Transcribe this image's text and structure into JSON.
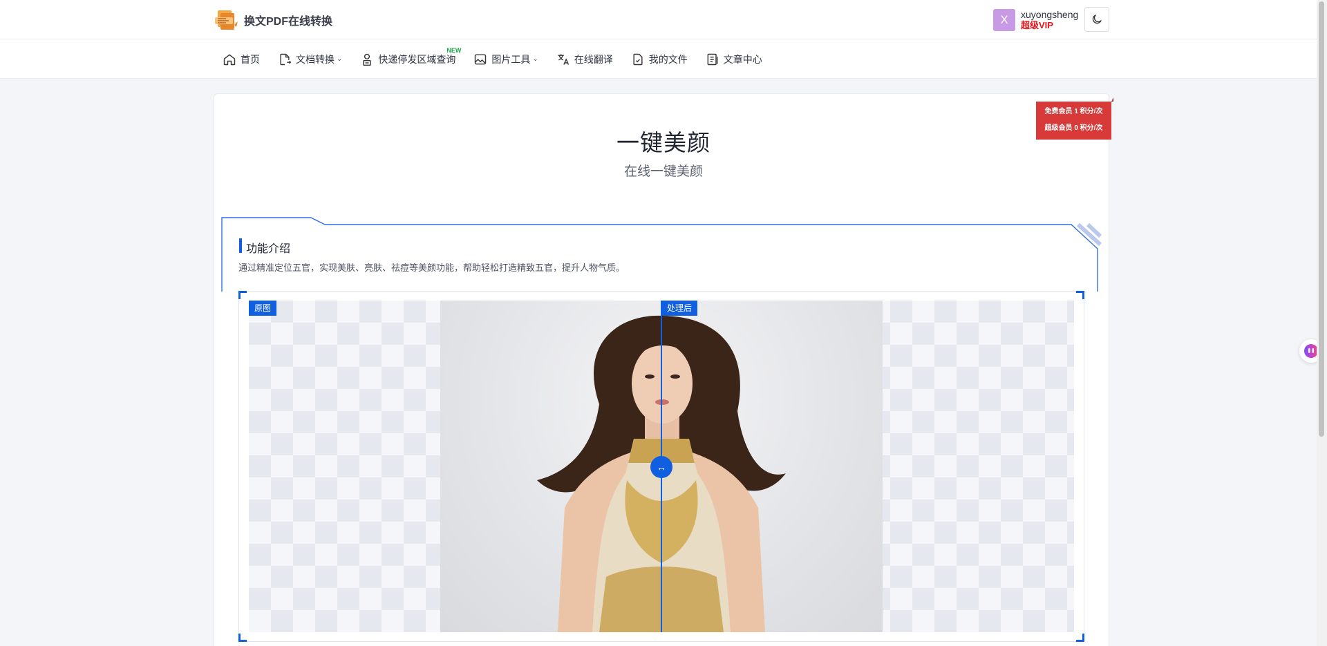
{
  "header": {
    "brand": "换文PDF在线转换",
    "user": {
      "avatar_letter": "X",
      "name": "xuyongsheng",
      "vip": "超级VIP"
    },
    "theme_icon": "moon-icon"
  },
  "nav": {
    "items": [
      {
        "label": "首页",
        "icon": "home-icon"
      },
      {
        "label": "文档转换",
        "icon": "document-convert-icon",
        "dropdown": true
      },
      {
        "label": "快递停发区域查询",
        "icon": "courier-icon",
        "badge": "NEW"
      },
      {
        "label": "图片工具",
        "icon": "image-icon",
        "dropdown": true
      },
      {
        "label": "在线翻译",
        "icon": "translate-icon"
      },
      {
        "label": "我的文件",
        "icon": "file-check-icon"
      },
      {
        "label": "文章中心",
        "icon": "article-icon"
      }
    ]
  },
  "pricing": {
    "free": "免费会员 1 积分/次",
    "vip": "超级会员 0 积分/次"
  },
  "page": {
    "title": "一键美颜",
    "subtitle": "在线一键美颜"
  },
  "section": {
    "title": "功能介绍",
    "description": "通过精准定位五官，实现美肤、亮肤、祛痘等美颜功能，帮助轻松打造精致五官，提升人物气质。"
  },
  "compare": {
    "before_label": "原图",
    "after_label": "处理后",
    "handle_glyph": "↔"
  },
  "colors": {
    "accent": "#0f5fe0",
    "vip_red": "#e4141b",
    "price_tag": "#d83a3a"
  }
}
